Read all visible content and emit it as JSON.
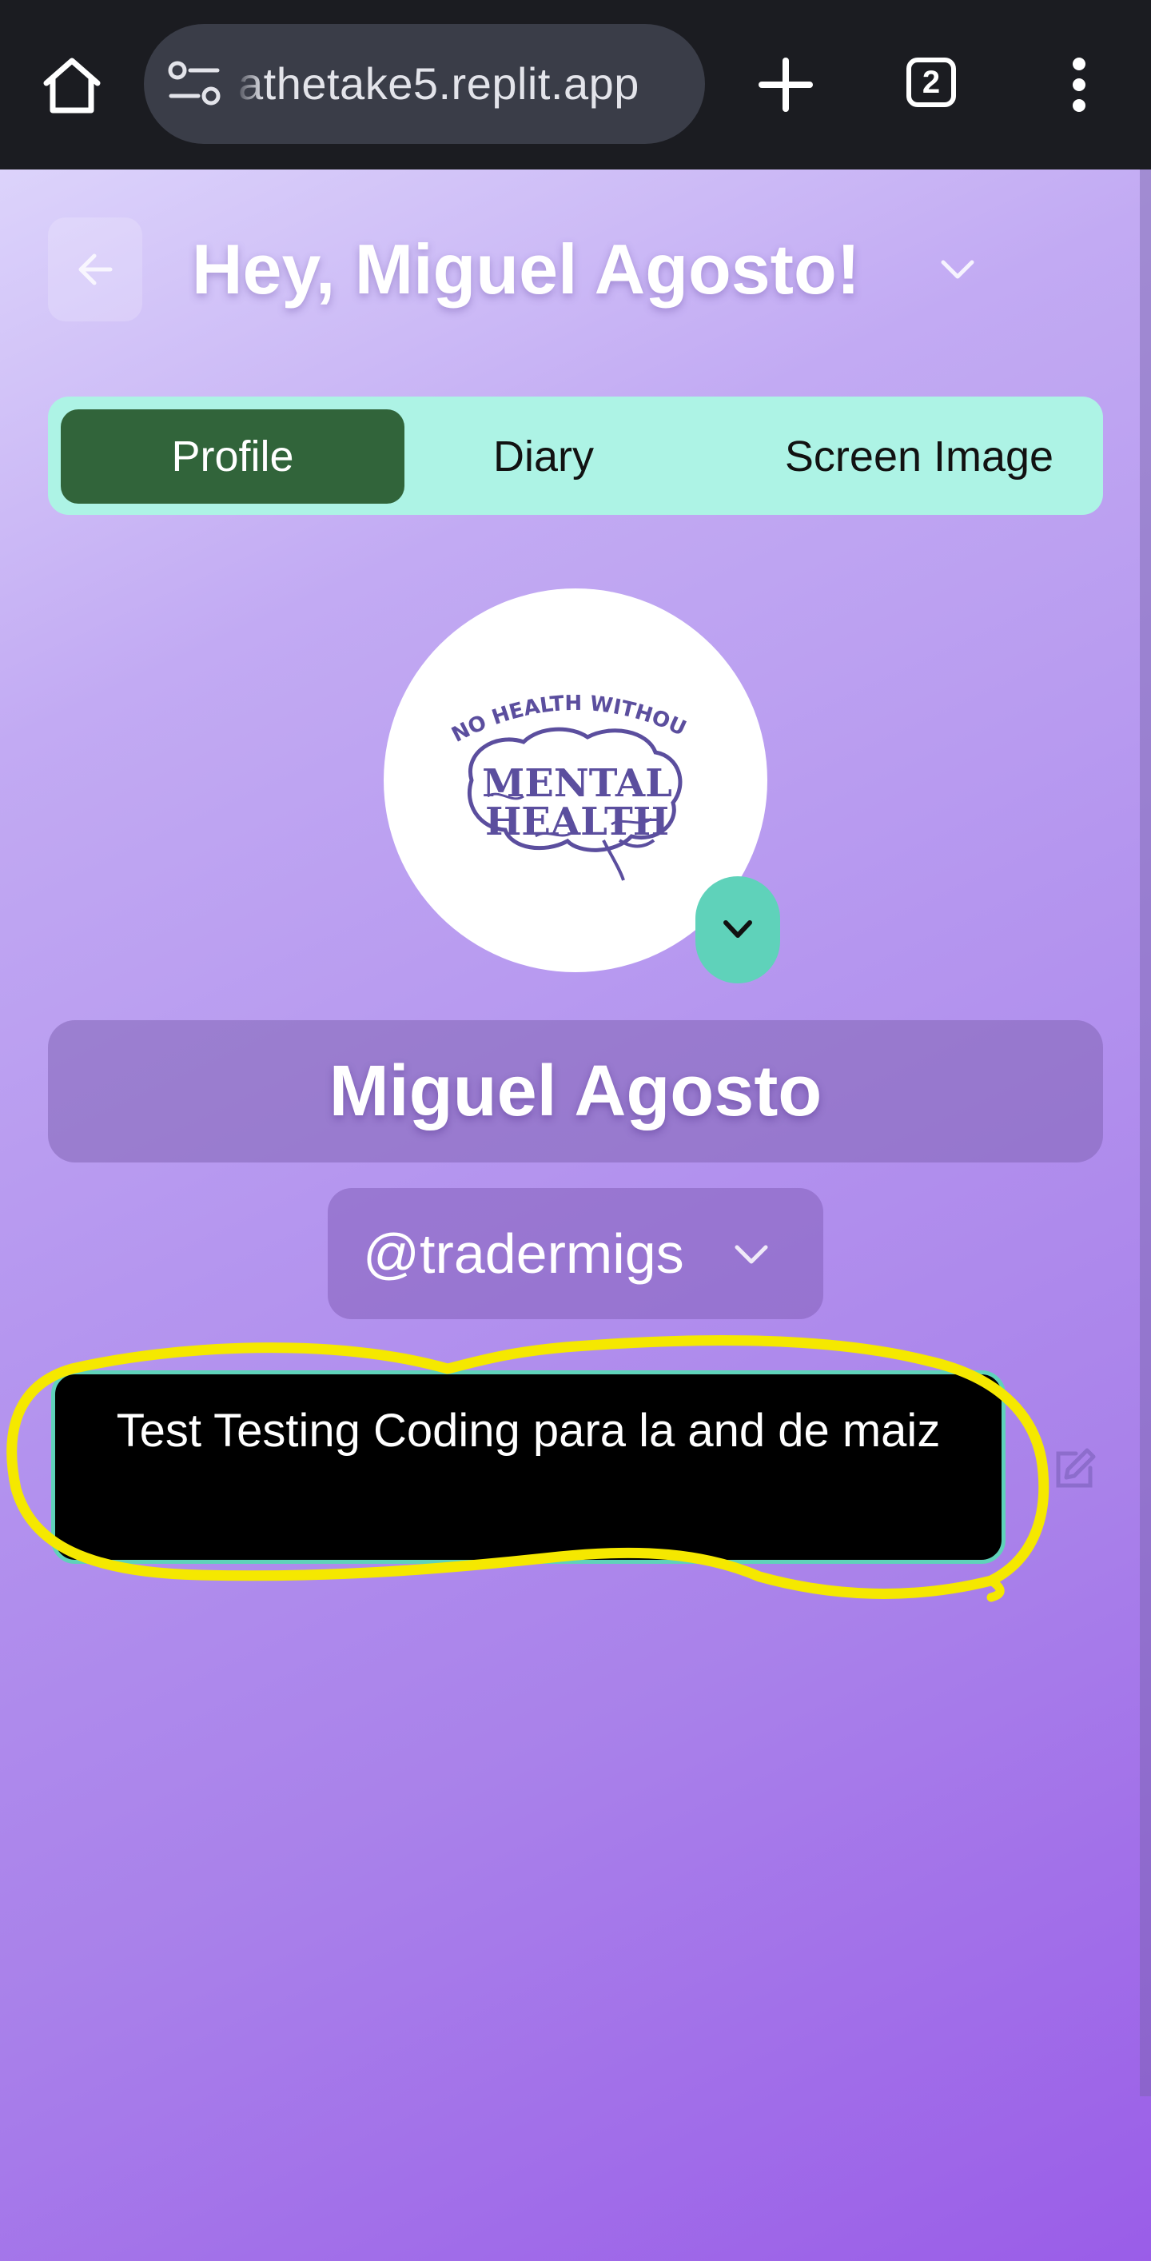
{
  "browser": {
    "url": "athetake5.replit.app",
    "tab_count": "2",
    "icons": {
      "home": "home-icon",
      "site_info": "tune-icon",
      "new_tab": "plus-icon",
      "menu": "more-vert-icon"
    }
  },
  "header": {
    "greeting": "Hey, Miguel Agosto!",
    "back_icon": "arrow-left-icon",
    "dropdown_icon": "chevron-down-icon"
  },
  "tabs": [
    {
      "label": "Profile",
      "active": true
    },
    {
      "label": "Diary",
      "active": false
    },
    {
      "label": "Screen Image",
      "active": false
    }
  ],
  "profile": {
    "avatar_logo": {
      "top_text": "NO HEALTH WITHOUT",
      "main_text": [
        "MENTAL",
        "HEALTH"
      ]
    },
    "display_name": "Miguel Agosto",
    "handle": "@tradermigs",
    "bio": "Test Testing Coding para la and de maiz"
  },
  "colors": {
    "tab_bar": "#adf3e5",
    "active_tab": "#31643a",
    "accent_teal": "#5fd2ba",
    "annotation_yellow": "#f5e800",
    "logo_purple": "#5b4e9e"
  }
}
